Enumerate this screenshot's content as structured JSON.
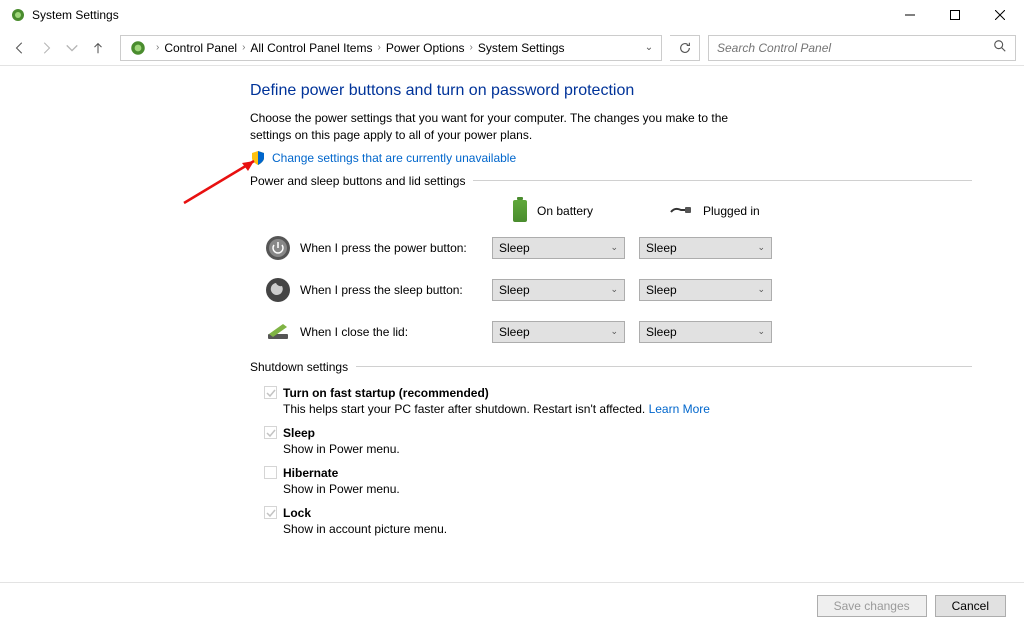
{
  "window": {
    "title": "System Settings"
  },
  "breadcrumbs": {
    "item1": "Control Panel",
    "item2": "All Control Panel Items",
    "item3": "Power Options",
    "item4": "System Settings"
  },
  "search": {
    "placeholder": "Search Control Panel"
  },
  "main": {
    "heading": "Define power buttons and turn on password protection",
    "intro": "Choose the power settings that you want for your computer. The changes you make to the settings on this page apply to all of your power plans.",
    "change_link": "Change settings that are currently unavailable"
  },
  "fieldset1": {
    "label": "Power and sleep buttons and lid settings",
    "col_battery": "On battery",
    "col_plugged": "Plugged in",
    "rows": [
      {
        "label": "When I press the power button:",
        "battery": "Sleep",
        "plugged": "Sleep"
      },
      {
        "label": "When I press the sleep button:",
        "battery": "Sleep",
        "plugged": "Sleep"
      },
      {
        "label": "When I close the lid:",
        "battery": "Sleep",
        "plugged": "Sleep"
      }
    ]
  },
  "fieldset2": {
    "label": "Shutdown settings",
    "items": [
      {
        "label": "Turn on fast startup (recommended)",
        "desc_pre": "This helps start your PC faster after shutdown. Restart isn't affected. ",
        "desc_link": "Learn More",
        "checked": true
      },
      {
        "label": "Sleep",
        "desc": "Show in Power menu.",
        "checked": true
      },
      {
        "label": "Hibernate",
        "desc": "Show in Power menu.",
        "checked": false
      },
      {
        "label": "Lock",
        "desc": "Show in account picture menu.",
        "checked": true
      }
    ]
  },
  "footer": {
    "save": "Save changes",
    "cancel": "Cancel"
  }
}
